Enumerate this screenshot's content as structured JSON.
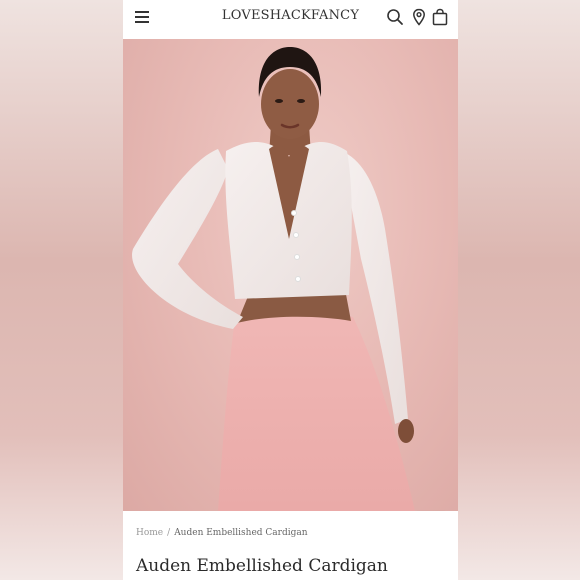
{
  "header": {
    "logo": "LOVESHACKFANCY"
  },
  "icons": {
    "menu": "menu-icon",
    "search": "search-icon",
    "location": "location-pin-icon",
    "bag": "shopping-bag-icon",
    "zoom": "zoom-icon"
  },
  "gallery": {
    "image_count": 5,
    "active_index": 0
  },
  "breadcrumb": {
    "home": "Home",
    "separator": "/",
    "current": "Auden Embellished Cardigan"
  },
  "product": {
    "title": "Auden Embellished Cardigan"
  },
  "colors": {
    "background_pink": "#e8bbb6",
    "text_dark": "#2b2b2b"
  }
}
